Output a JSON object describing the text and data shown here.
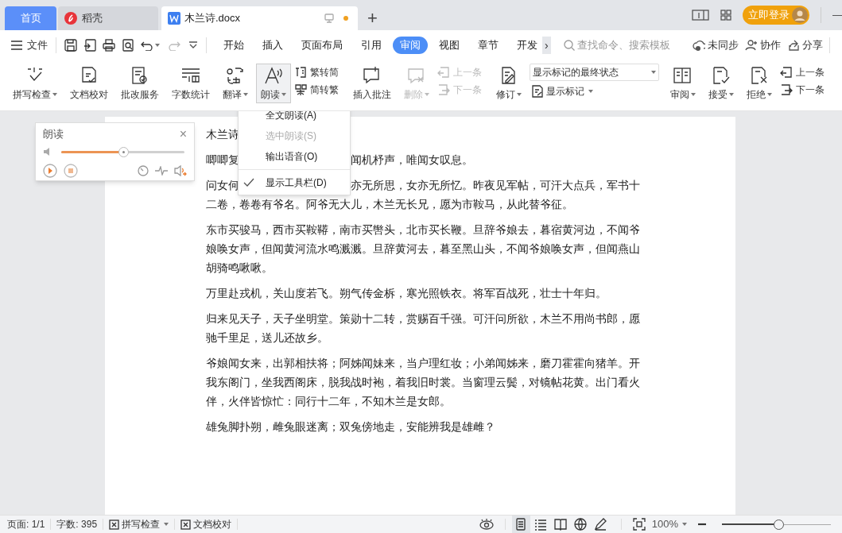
{
  "tabs": [
    {
      "kind": "home",
      "label": "首页",
      "selected": false
    },
    {
      "kind": "docer",
      "label": "稻壳",
      "selected": false
    },
    {
      "kind": "doc",
      "label": "木兰诗.docx",
      "selected": true,
      "unsaved": true
    }
  ],
  "titlebar": {
    "add": "+",
    "login": "立即登录",
    "minimize": "—"
  },
  "menubar": {
    "file": "文件",
    "tabs": [
      {
        "label": "开始",
        "selected": false
      },
      {
        "label": "插入",
        "selected": false
      },
      {
        "label": "页面布局",
        "selected": false
      },
      {
        "label": "引用",
        "selected": false
      },
      {
        "label": "审阅",
        "selected": true
      },
      {
        "label": "视图",
        "selected": false
      },
      {
        "label": "章节",
        "selected": false
      },
      {
        "label": "开发",
        "selected": false
      }
    ],
    "more": "›",
    "search": {
      "placeholder": "查找命令、搜索模板"
    },
    "actions": [
      "未同步",
      "协作",
      "分享"
    ]
  },
  "ribbon": [
    {
      "kind": "big",
      "label": "拼写检查",
      "caret": true,
      "disabled": false,
      "pressed": false
    },
    {
      "kind": "big",
      "label": "文档校对",
      "caret": false,
      "disabled": false,
      "pressed": false
    },
    {
      "kind": "big",
      "label": "批改服务",
      "caret": false,
      "disabled": false,
      "pressed": false
    },
    {
      "kind": "big",
      "label": "字数统计",
      "caret": false,
      "disabled": false,
      "pressed": false
    },
    {
      "kind": "big",
      "label": "翻译",
      "caret": true,
      "disabled": false,
      "pressed": false
    },
    {
      "kind": "big",
      "label": "朗读",
      "caret": true,
      "disabled": false,
      "pressed": true
    },
    {
      "kind": "pair",
      "items": [
        {
          "label": "繁转简",
          "disabled": false
        },
        {
          "label": "简转繁",
          "disabled": false
        }
      ]
    },
    {
      "kind": "big",
      "label": "插入批注",
      "caret": false,
      "disabled": false,
      "pressed": false
    },
    {
      "kind": "big",
      "label": "删除",
      "caret": true,
      "disabled": true,
      "pressed": false
    },
    {
      "kind": "pair",
      "items": [
        {
          "label": "上一条",
          "disabled": true
        },
        {
          "label": "下一条",
          "disabled": true
        }
      ]
    },
    {
      "kind": "big",
      "label": "修订",
      "caret": true,
      "disabled": false,
      "pressed": false
    },
    {
      "kind": "combo",
      "value": "显示标记的最终状态",
      "label": "显示标记"
    },
    {
      "kind": "big",
      "label": "审阅",
      "caret": true,
      "disabled": false,
      "pressed": false
    },
    {
      "kind": "big",
      "label": "接受",
      "caret": true,
      "disabled": false,
      "pressed": false
    },
    {
      "kind": "big",
      "label": "拒绝",
      "caret": true,
      "disabled": false,
      "pressed": false
    },
    {
      "kind": "pair",
      "items": [
        {
          "label": "上一条",
          "disabled": false
        },
        {
          "label": "下一条",
          "disabled": false
        }
      ]
    }
  ],
  "document": {
    "paragraphs": [
      {
        "left": "木兰诗"
      },
      {
        "left": "唧唧复",
        "right": "闻机杼声，唯闻女叹息。"
      },
      {
        "left": "问女何",
        "right": "亦无所思，女亦无所忆。昨夜见军帖，可汗大点兵，军书十",
        "rest": "二卷，卷卷有爷名。阿爷无大儿，木兰无长兄，愿为市鞍马，从此替爷征。"
      },
      {
        "left": "东市买骏马，西市买鞍鞯，南市买辔头，北市买长鞭。旦辞爷娘去，暮宿黄河边，不闻爷娘唤女声，但闻黄河流水鸣溅溅。旦辞黄河去，暮至黑山头，不闻爷娘唤女声，但闻燕山胡骑鸣啾啾。"
      },
      {
        "left": "万里赴戎机，关山度若飞。朔气传金柝，寒光照铁衣。将军百战死，壮士十年归。"
      },
      {
        "left": "归来见天子，天子坐明堂。策勋十二转，赏赐百千强。可汗问所欲，木兰不用尚书郎，愿驰千里足，送儿还故乡。"
      },
      {
        "left": "爷娘闻女来，出郭相扶将；阿姊闻妹来，当户理红妆；小弟闻姊来，磨刀霍霍向猪羊。开我东阁门，坐我西阁床，脱我战时袍，着我旧时裳。当窗理云鬓，对镜帖花黄。出门看火伴，火伴皆惊忙：同行十二年，不知木兰是女郎。"
      },
      {
        "left": "雄兔脚扑朔，雌兔眼迷离；双兔傍地走，安能辨我是雄雌？"
      }
    ]
  },
  "reader": {
    "title": "朗读",
    "close": "×",
    "level": 0.5
  },
  "menu": [
    {
      "label": "全文朗读(A)",
      "disabled": false,
      "checked": false
    },
    {
      "label": "选中朗读(S)",
      "disabled": true,
      "checked": false
    },
    {
      "label": "输出语音(O)",
      "disabled": false,
      "checked": false,
      "separator_after": true
    },
    {
      "label": "显示工具栏(D)",
      "disabled": false,
      "checked": true
    }
  ],
  "status_bar": {
    "page": "页面: 1/1",
    "words": "字数: 395",
    "spell": "拼写检查",
    "proof": "文档校对",
    "views": [
      {
        "selected": true
      },
      {
        "selected": false
      },
      {
        "selected": false
      },
      {
        "selected": false
      },
      {
        "selected": false
      }
    ],
    "zoom": "100%",
    "zoom_level": {
      "level": 0.52
    }
  }
}
